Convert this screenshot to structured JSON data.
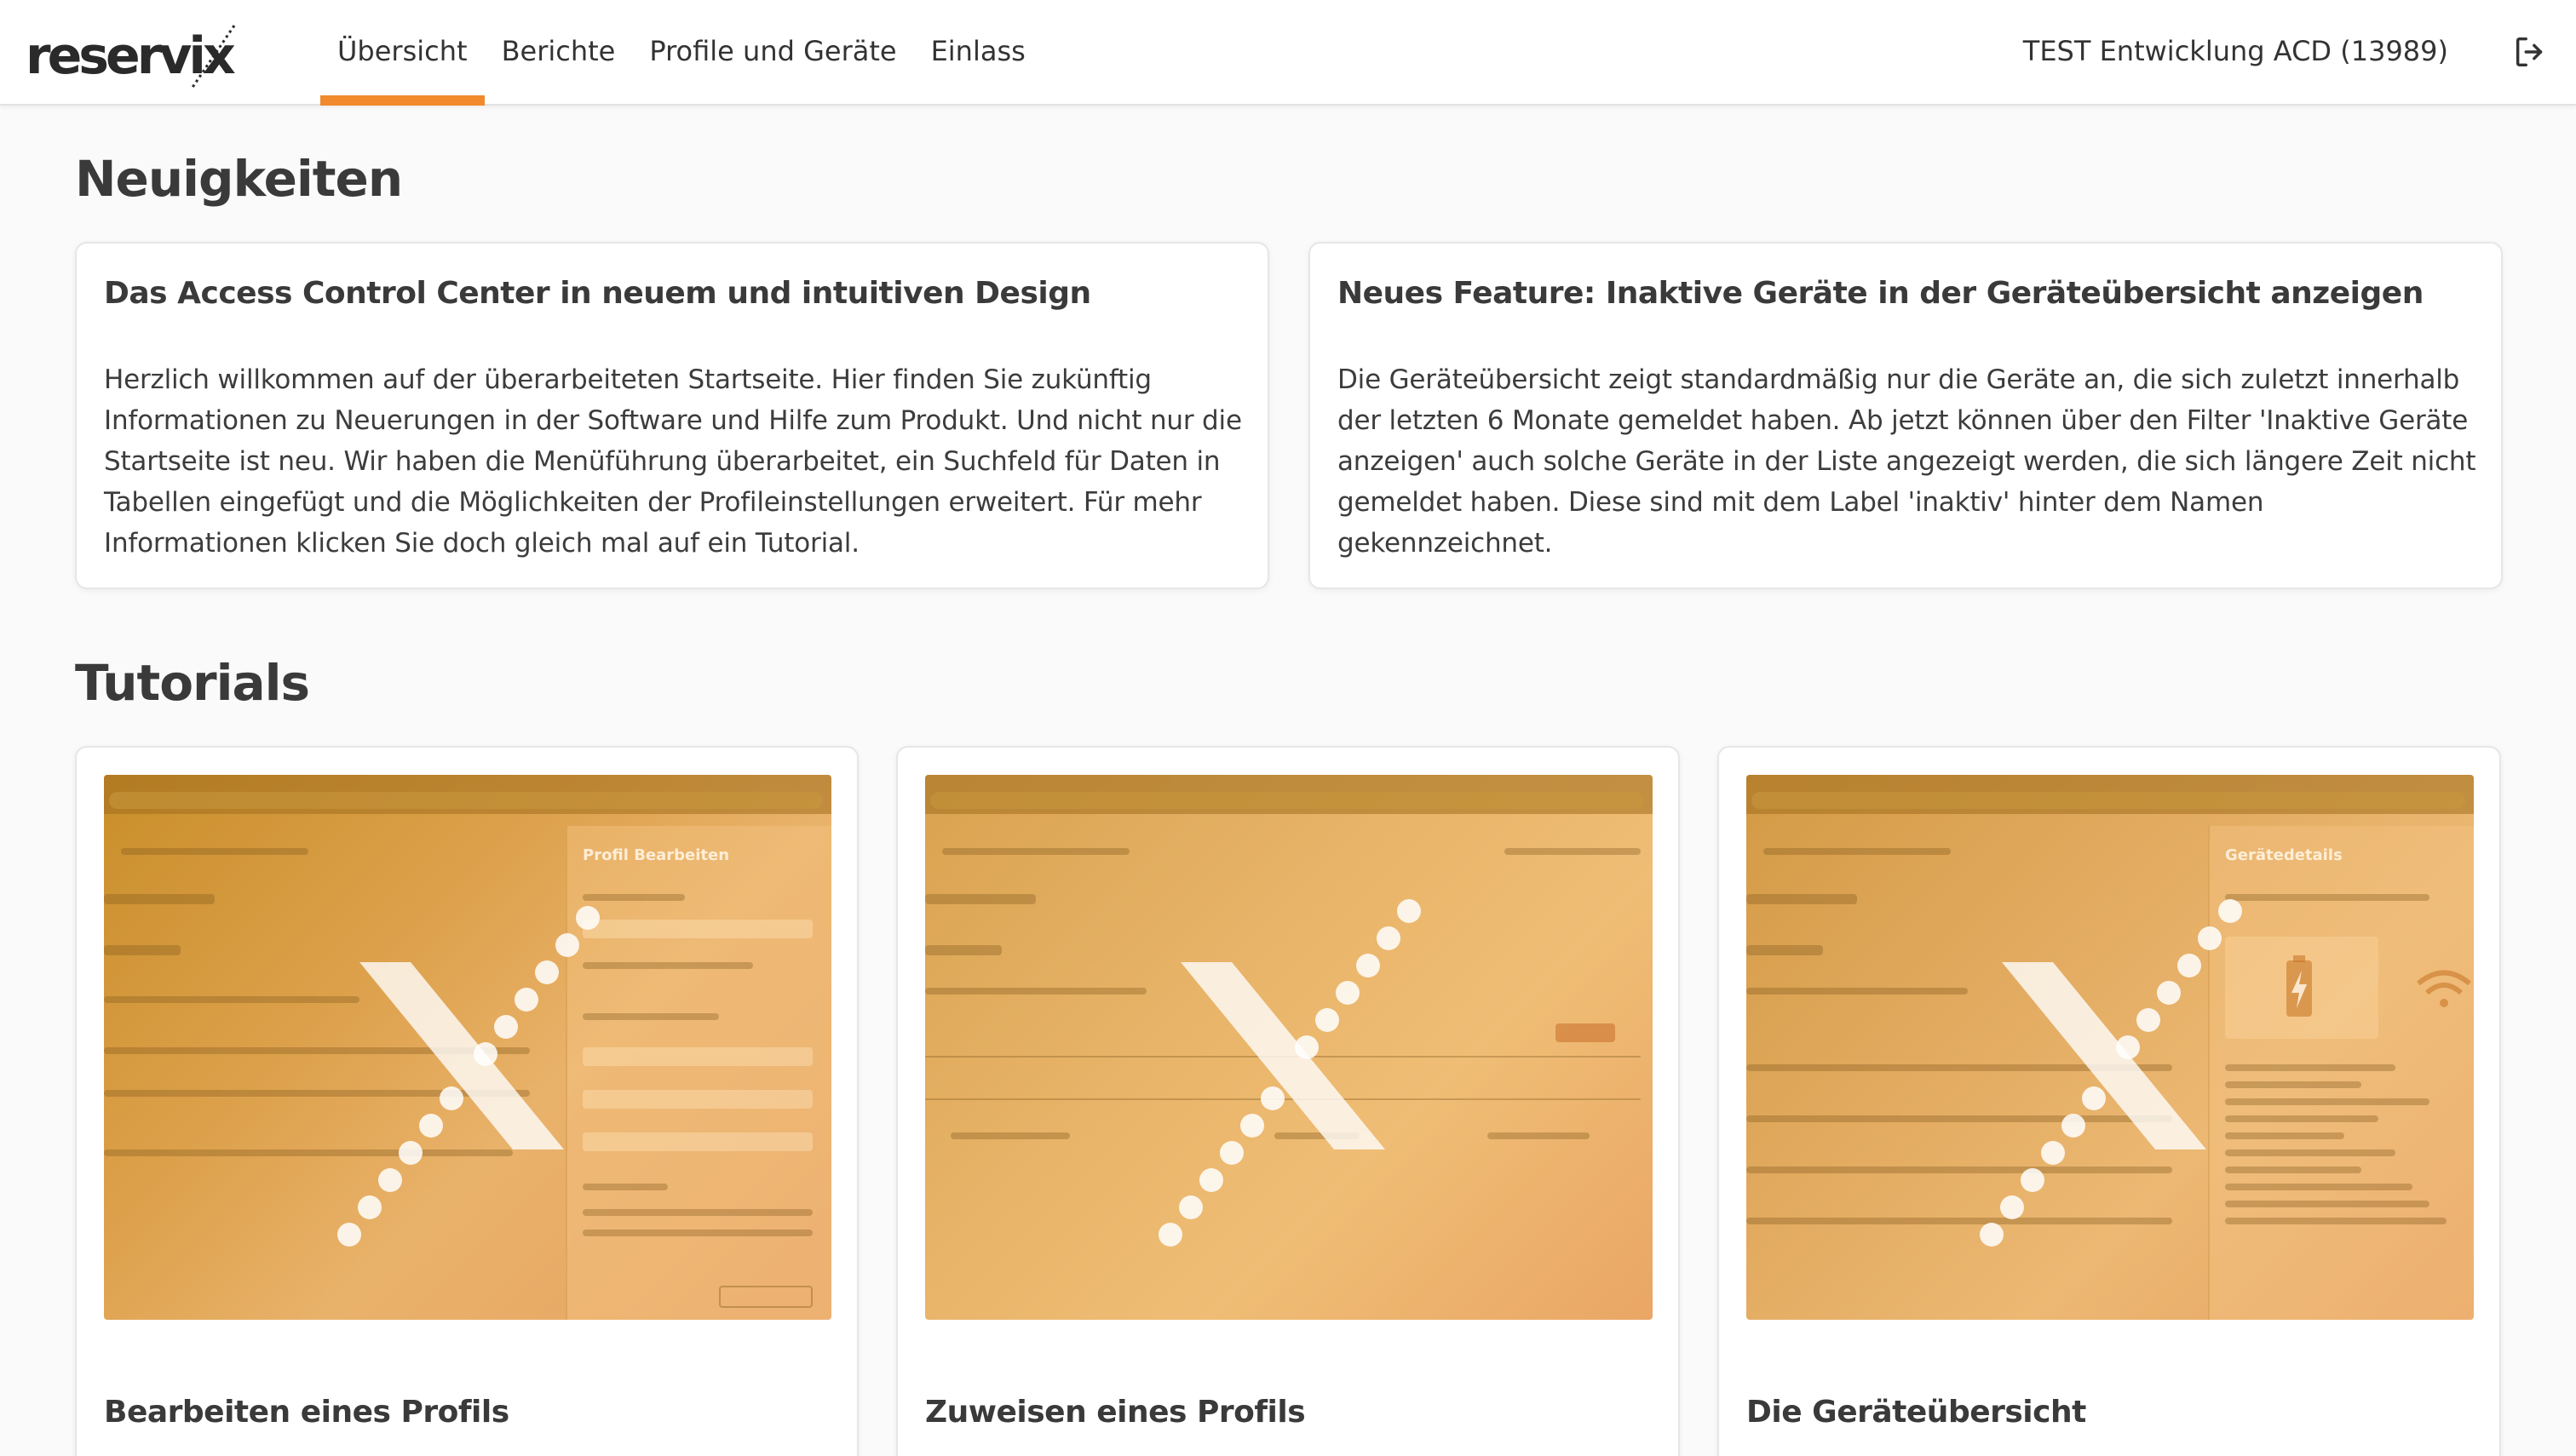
{
  "header": {
    "logo_text": "reservix",
    "nav": [
      {
        "label": "Übersicht",
        "active": true
      },
      {
        "label": "Berichte",
        "active": false
      },
      {
        "label": "Profile und Geräte",
        "active": false
      },
      {
        "label": "Einlass",
        "active": false
      }
    ],
    "organization": "TEST Entwicklung ACD (13989)",
    "logout_icon": "logout-icon"
  },
  "colors": {
    "accent": "#f08a2c",
    "text": "#3a3a3a",
    "background": "#fafafa"
  },
  "news": {
    "title": "Neuigkeiten",
    "items": [
      {
        "title": "Das Access Control Center in neuem und intuitiven Design",
        "body": "Herzlich willkommen auf der überarbeiteten Startseite. Hier finden Sie zukünftig Informationen zu Neuerungen in der Software und Hilfe zum Produkt. Und nicht nur die Startseite ist neu. Wir haben die Menüführung überarbeitet, ein Suchfeld für Daten in Tabellen eingefügt und die Möglichkeiten der Profileinstellungen erweitert. Für mehr Informationen klicken Sie doch gleich mal auf ein Tutorial."
      },
      {
        "title": "Neues Feature: Inaktive Geräte in der Geräteübersicht anzeigen",
        "body": "Die Geräteübersicht zeigt standardmäßig nur die Geräte an, die sich zuletzt innerhalb der letzten 6 Monate gemeldet haben. Ab jetzt können über den Filter 'Inaktive Geräte anzeigen' auch solche Geräte in der Liste angezeigt werden, die sich längere Zeit nicht gemeldet haben. Diese sind mit dem Label 'inaktiv' hinter dem Namen gekennzeichnet."
      }
    ]
  },
  "tutorials": {
    "title": "Tutorials",
    "items": [
      {
        "title": "Bearbeiten eines Profils",
        "panel_heading": "Profil Bearbeiten"
      },
      {
        "title": "Zuweisen eines Profils",
        "panel_heading": ""
      },
      {
        "title": "Die Geräteübersicht",
        "panel_heading": "Gerätedetails"
      }
    ]
  }
}
